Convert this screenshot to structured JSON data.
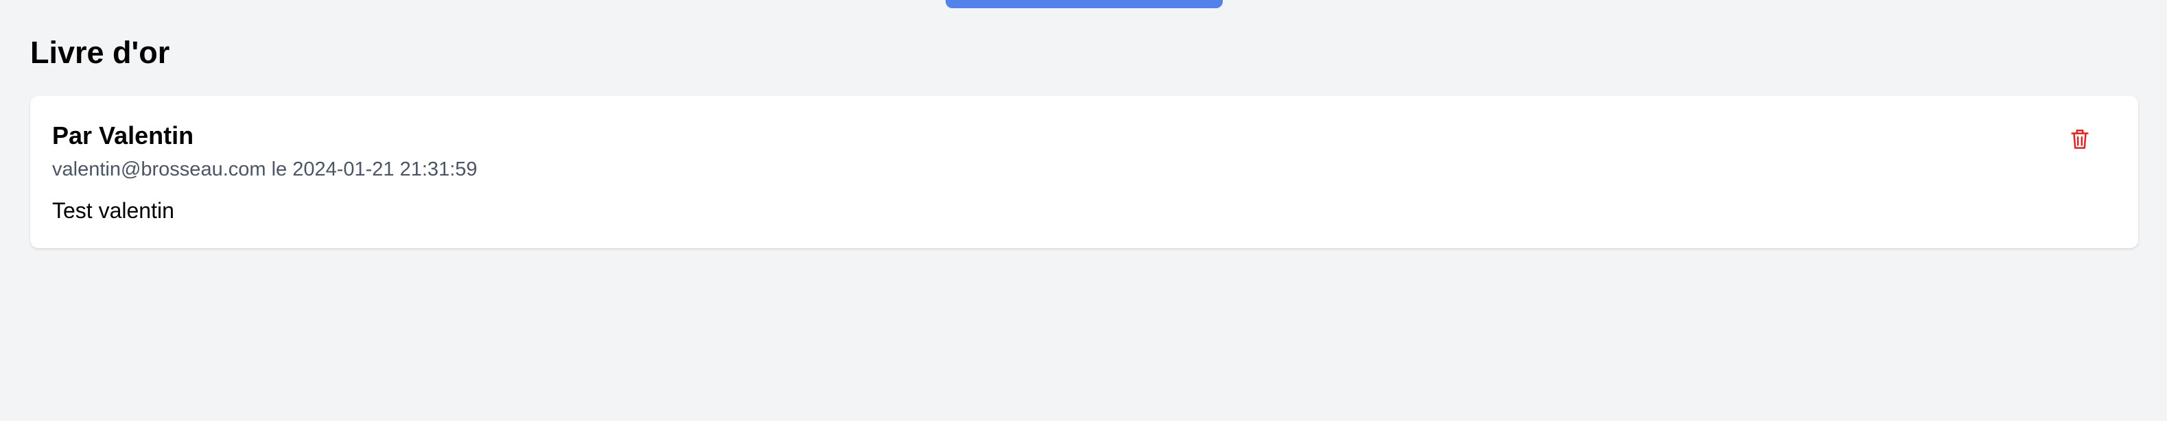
{
  "header": {
    "title": "Livre d'or"
  },
  "entries": [
    {
      "author_label": "Par Valentin",
      "meta": "valentin@brosseau.com le 2024-01-21 21:31:59",
      "message": "Test valentin",
      "delete_icon": "trash-icon"
    }
  ],
  "colors": {
    "accent_blue": "#5282ea",
    "delete_red": "#dc2626",
    "background": "#f3f4f6"
  }
}
